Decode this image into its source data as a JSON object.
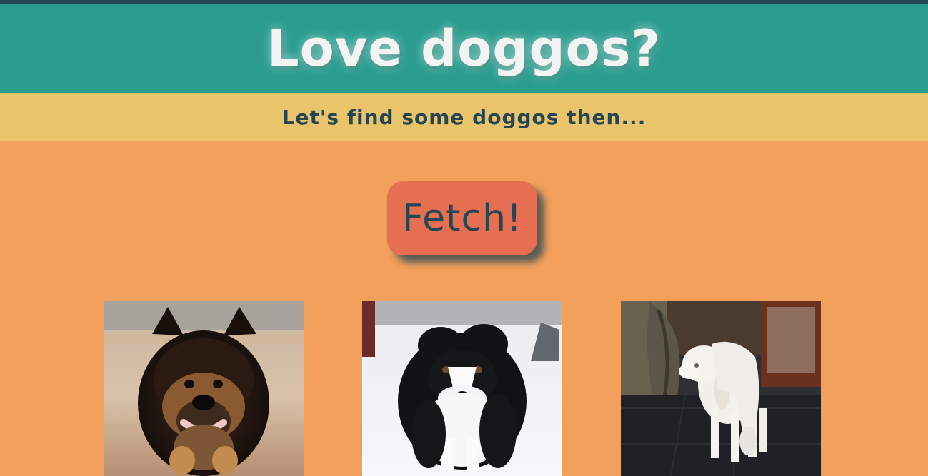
{
  "header": {
    "title": "Love doggos?"
  },
  "subheader": {
    "text": "Let's find some doggos then..."
  },
  "actions": {
    "fetch_label": "Fetch!"
  },
  "gallery": {
    "images": [
      {
        "subject": "black-and-tan-fluffy-dog"
      },
      {
        "subject": "black-and-white-dog-in-snow"
      },
      {
        "subject": "white-curly-dog-by-door"
      }
    ]
  },
  "colors": {
    "top_strip": "#264653",
    "header_bg": "#2a9d8f",
    "subheader_bg": "#e9c46a",
    "page_bg": "#f2a05c",
    "button_bg": "#e76f51",
    "button_text": "#264653",
    "title_text": "#f1f3f4",
    "subheader_text": "#264653"
  }
}
